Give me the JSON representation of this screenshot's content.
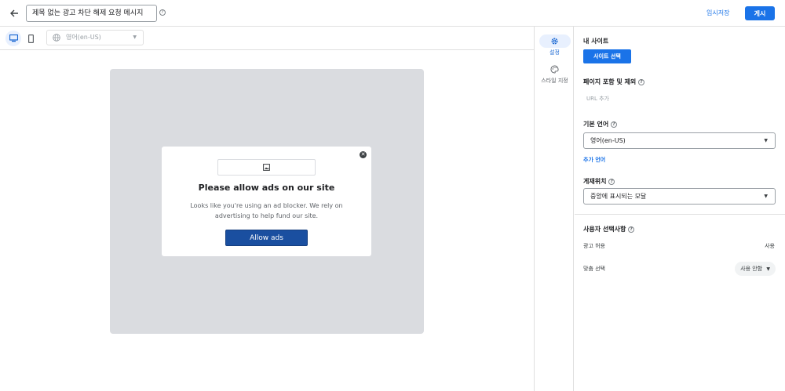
{
  "header": {
    "title_value": "제목 없는 광고 차단 해제 요청 메시지",
    "save_draft_label": "임시저장",
    "publish_label": "게시"
  },
  "preview_toolbar": {
    "language_value": "영어(en-US)"
  },
  "modal": {
    "title": "Please allow ads on our site",
    "body": "Looks like you're using an ad blocker. We rely on advertising to help fund our site.",
    "button_label": "Allow ads"
  },
  "rail": {
    "items": [
      {
        "label": "설정",
        "icon": "gear-icon",
        "active": true
      },
      {
        "label": "스타일 지정",
        "icon": "palette-icon",
        "active": false
      }
    ]
  },
  "settings": {
    "my_site_label": "내 사이트",
    "select_site_button": "사이트 선택",
    "include_exclude_pages_label": "페이지 포함 및 제외",
    "url_add_placeholder": "URL 추가",
    "default_language_label": "기본 언어",
    "default_language_value": "영어(en-US)",
    "add_language_link": "추가 언어",
    "placement_label": "게재위치",
    "placement_value": "중앙에 표시되는 모달",
    "user_choices_label": "사용자 선택사항",
    "allow_ads_label": "광고 허용",
    "allow_ads_value": "사용",
    "custom_choice_label": "맞춤 선택",
    "custom_choice_value": "사용 안함"
  },
  "colors": {
    "accent": "#1a73e8",
    "allow_button": "#1a4fa0",
    "stage_background": "#dadce0"
  }
}
